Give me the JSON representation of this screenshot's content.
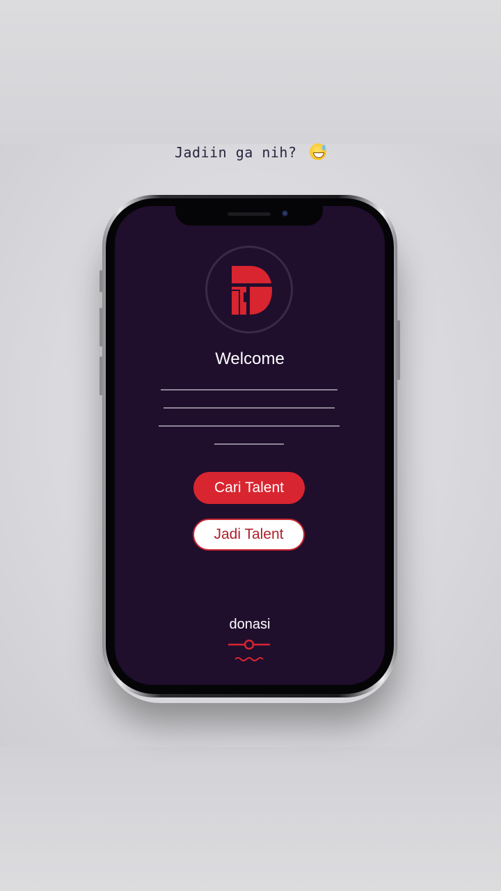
{
  "caption": "Jadiin ga nih? ",
  "caption_emoji": "sweat-smile-emoji",
  "welcome": "Welcome",
  "buttons": {
    "cari": "Cari Talent",
    "jadi": "Jadi Talent"
  },
  "donasi": "donasi",
  "colors": {
    "screen_bg": "#200e2d",
    "accent": "#d82530",
    "text_light": "#ffffff"
  }
}
